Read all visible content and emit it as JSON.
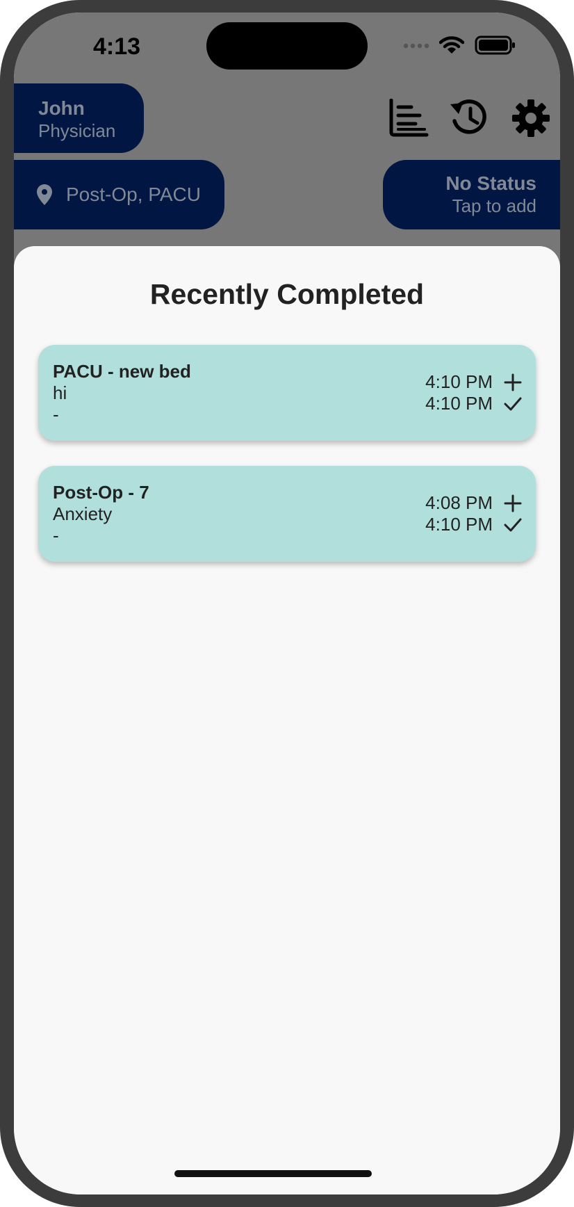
{
  "status_bar": {
    "time": "4:13"
  },
  "header": {
    "user": {
      "name": "John",
      "role": "Physician"
    },
    "location": "Post-Op, PACU",
    "status": {
      "title": "No Status",
      "subtitle": "Tap to add"
    },
    "icons": [
      "chart-icon",
      "history-icon",
      "settings-icon"
    ]
  },
  "sheet": {
    "title": "Recently Completed",
    "cards": [
      {
        "title": "PACU - new bed",
        "line1": "hi",
        "line2": "-",
        "created": "4:10 PM",
        "completed": "4:10 PM"
      },
      {
        "title": "Post-Op - 7",
        "line1": "Anxiety",
        "line2": "-",
        "created": "4:08 PM",
        "completed": "4:10 PM"
      }
    ]
  },
  "colors": {
    "pill": "#011642",
    "card": "#b1dfdc",
    "overlay": "#777777"
  }
}
